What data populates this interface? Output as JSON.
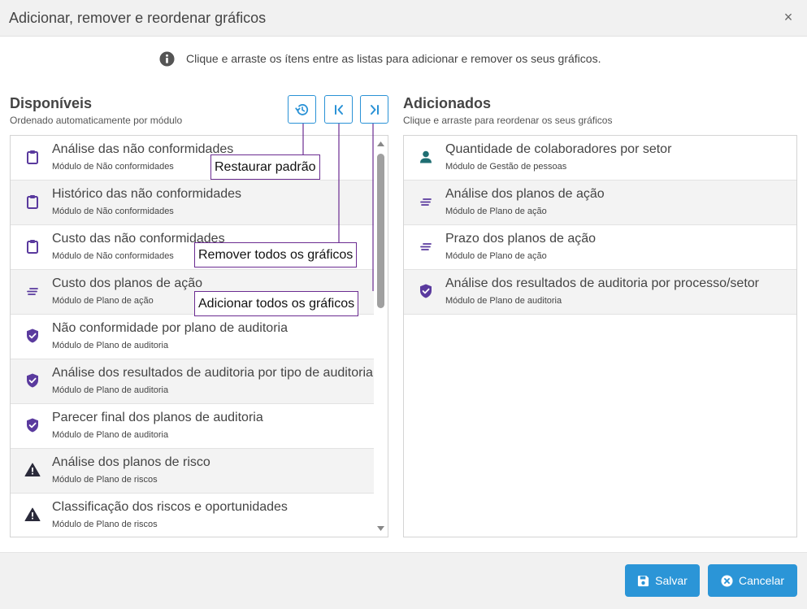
{
  "dialog": {
    "title": "Adicionar, remover e reordenar gráficos",
    "close_label": "×",
    "info_text": "Clique e arraste os ítens entre as listas para adicionar e remover os seus gráficos."
  },
  "available": {
    "title": "Disponíveis",
    "subtitle": "Ordenado automaticamente por módulo",
    "items": [
      {
        "title": "Análise das não conformidades",
        "module": "Módulo de Não conformidades",
        "icon": "clipboard-icon"
      },
      {
        "title": "Histórico das não conformidades",
        "module": "Módulo de Não conformidades",
        "icon": "clipboard-icon"
      },
      {
        "title": "Custo das não conformidades",
        "module": "Módulo de Não conformidades",
        "icon": "clipboard-icon"
      },
      {
        "title": "Custo dos planos de ação",
        "module": "Módulo de Plano de ação",
        "icon": "lines-icon"
      },
      {
        "title": "Não conformidade por plano de auditoria",
        "module": "Módulo de Plano de auditoria",
        "icon": "shield-check-icon"
      },
      {
        "title": "Análise dos resultados de auditoria por tipo de auditoria",
        "module": "Módulo de Plano de auditoria",
        "icon": "shield-check-icon"
      },
      {
        "title": "Parecer final dos planos de auditoria",
        "module": "Módulo de Plano de auditoria",
        "icon": "shield-check-icon"
      },
      {
        "title": "Análise dos planos de risco",
        "module": "Módulo de Plano de riscos",
        "icon": "warning-icon"
      },
      {
        "title": "Classificação dos riscos e oportunidades",
        "module": "Módulo de Plano de riscos",
        "icon": "warning-icon"
      }
    ]
  },
  "added": {
    "title": "Adicionados",
    "subtitle": "Clique e arraste para reordenar os seus gráficos",
    "items": [
      {
        "title": "Quantidade de colaboradores por setor",
        "module": "Módulo de Gestão de pessoas",
        "icon": "person-icon"
      },
      {
        "title": "Análise dos planos de ação",
        "module": "Módulo de Plano de ação",
        "icon": "lines-icon"
      },
      {
        "title": "Prazo dos planos de ação",
        "module": "Módulo de Plano de ação",
        "icon": "lines-icon"
      },
      {
        "title": "Análise dos resultados de auditoria por processo/setor",
        "module": "Módulo de Plano de auditoria",
        "icon": "shield-check-icon"
      }
    ]
  },
  "callouts": {
    "restore": "Restaurar padrão",
    "remove_all": "Remover todos os gráficos",
    "add_all": "Adicionar todos os gráficos"
  },
  "footer": {
    "save_label": "Salvar",
    "cancel_label": "Cancelar"
  },
  "colors": {
    "accent": "#2b95d7",
    "icon_purple": "#5a3a9e",
    "icon_teal": "#1f6e72",
    "icon_dark": "#2a2a3a",
    "callout_border": "#6b2c91"
  }
}
